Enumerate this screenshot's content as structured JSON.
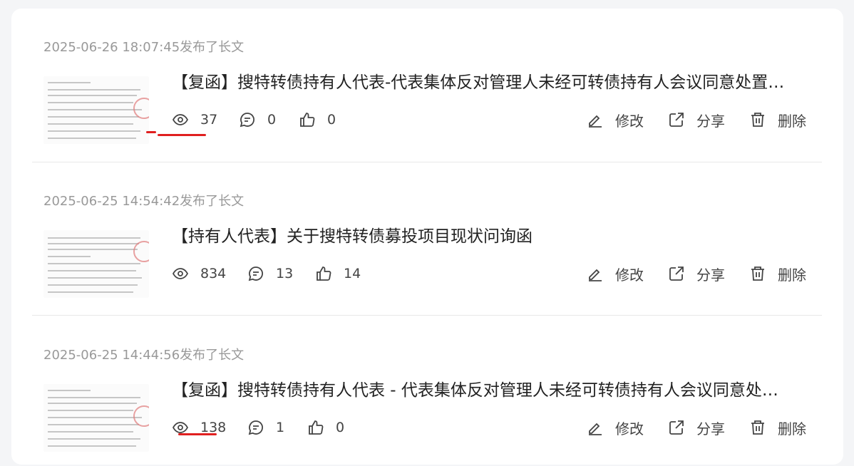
{
  "posts": [
    {
      "date": "2025-06-26 18:07:45发布了长文",
      "title": "【复函】搜特转债持有人代表-代表集体反对管理人未经可转债持有人会议同意处置…",
      "views": "37",
      "comments": "0",
      "likes": "0"
    },
    {
      "date": "2025-06-25 14:54:42发布了长文",
      "title": "【持有人代表】关于搜特转债募投项目现状问询函",
      "views": "834",
      "comments": "13",
      "likes": "14"
    },
    {
      "date": "2025-06-25 14:44:56发布了长文",
      "title": "【复函】搜特转债持有人代表 - 代表集体反对管理人未经可转债持有人会议同意处…",
      "views": "138",
      "comments": "1",
      "likes": "0"
    }
  ],
  "actions": {
    "edit_label": "修改",
    "share_label": "分享",
    "delete_label": "删除"
  },
  "icons": {
    "views": "eye-icon",
    "comments": "comment-icon",
    "likes": "thumbs-up-icon",
    "edit": "edit-icon",
    "share": "share-icon",
    "delete": "trash-icon"
  },
  "colors": {
    "annotation": "#e02020"
  }
}
